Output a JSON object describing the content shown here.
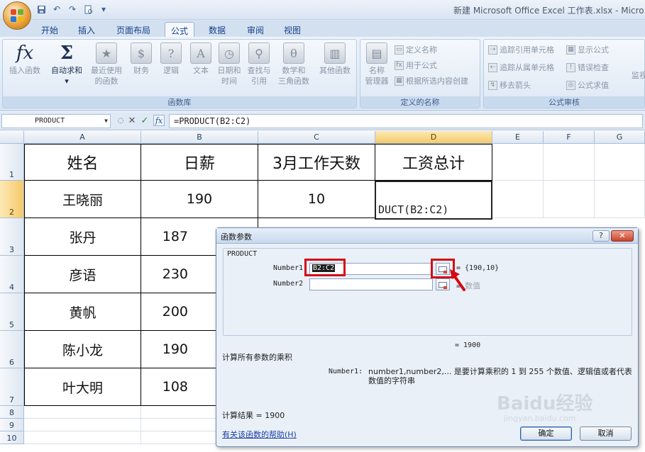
{
  "window": {
    "title": "新建 Microsoft Office Excel 工作表.xlsx - Micro"
  },
  "quick_access": {
    "icons": [
      "save-icon",
      "undo-icon",
      "redo-icon",
      "print-preview-icon",
      "customize-qat-icon"
    ]
  },
  "tabs": [
    "开始",
    "插入",
    "页面布局",
    "公式",
    "数据",
    "审阅",
    "视图"
  ],
  "active_tab": "公式",
  "ribbon": {
    "function_library": {
      "label": "函数库",
      "insert_function": "插入函数",
      "autosum": "自动求和",
      "recent_line1": "最近使用",
      "recent_line2": "的函数",
      "financial": "财务",
      "logical": "逻辑",
      "text": "文本",
      "datetime_line1": "日期和",
      "datetime_line2": "时间",
      "lookup_line1": "查找与",
      "lookup_line2": "引用",
      "math_line1": "数学和",
      "math_line2": "三角函数",
      "more": "其他函数"
    },
    "defined_names": {
      "label": "定义的名称",
      "name_manager_line1": "名称",
      "name_manager_line2": "管理器",
      "define_name": "定义名称",
      "use_in_formula": "用于公式",
      "create_from_selection": "根据所选内容创建"
    },
    "formula_auditing": {
      "label": "公式审核",
      "trace_precedents": "追踪引用单元格",
      "trace_dependents": "追踪从属单元格",
      "remove_arrows": "移去箭头",
      "show_formulas": "显示公式",
      "error_checking": "错误检查",
      "evaluate_formula": "公式求值",
      "watch": "监视"
    }
  },
  "formula_bar": {
    "name_box": "PRODUCT",
    "formula": "=PRODUCT(B2:C2)"
  },
  "sheet": {
    "columns": [
      "A",
      "B",
      "C",
      "D",
      "E",
      "F",
      "G"
    ],
    "rows": [
      "1",
      "2",
      "3",
      "4",
      "5",
      "6",
      "7",
      "8",
      "9",
      "10"
    ],
    "headers": [
      "姓名",
      "日薪",
      "3月工作天数",
      "工资总计"
    ],
    "data": [
      [
        "王晓丽",
        "190",
        "10"
      ],
      [
        "张丹",
        "187",
        ""
      ],
      [
        "彦语",
        "230",
        ""
      ],
      [
        "黄帆",
        "200",
        ""
      ],
      [
        "陈小龙",
        "190",
        ""
      ],
      [
        "叶大明",
        "108",
        ""
      ]
    ],
    "editing_cell_text": "DUCT(B2:C2)"
  },
  "dialog": {
    "title": "函数参数",
    "help_btn": "?",
    "close_btn": "✕",
    "function_name": "PRODUCT",
    "arg1_label": "Number1",
    "arg1_value": "B2:C2",
    "arg1_result": "=  {190,10}",
    "arg2_label": "Number2",
    "arg2_value": "",
    "arg2_result": "=",
    "arg2_hint": "数值",
    "result_eq": "=  1900",
    "description": "计算所有参数的乘积",
    "arg_desc_label": "Number1:",
    "arg_desc": "number1,number2,... 是要计算乘积的 1 到 255 个数值、逻辑值或者代表数值的字符串",
    "calc_result": "计算结果 =  1900",
    "help_link": "有关该函数的帮助(H)",
    "ok": "确定",
    "cancel": "取消"
  },
  "watermark": {
    "brand": "Baidu经验",
    "url": "jingyan.baidu.com"
  },
  "colors": {
    "highlight": "#d40a14",
    "selected_header": "#f5c96a"
  }
}
